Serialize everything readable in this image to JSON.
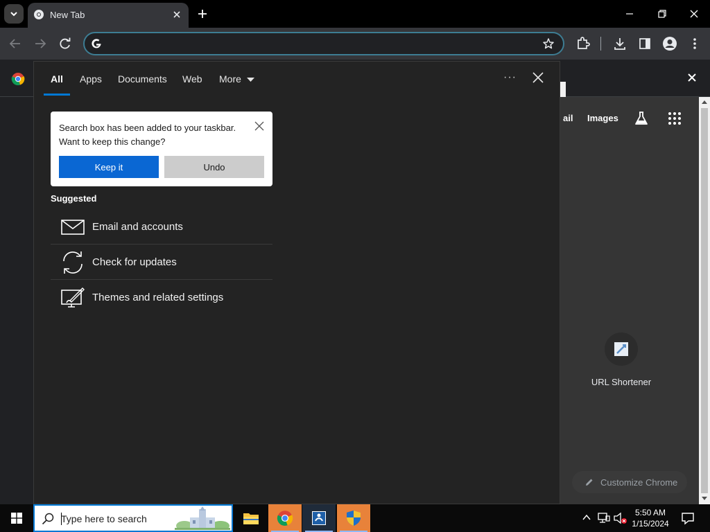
{
  "browser": {
    "tab_title": "New Tab",
    "omnibox_value": "",
    "omnibox_placeholder": ""
  },
  "ntp": {
    "link_gmail": "ail",
    "link_images": "Images",
    "shortcut_label": "URL Shortener",
    "customize_label": "Customize Chrome"
  },
  "search_panel": {
    "tabs": [
      {
        "label": "All"
      },
      {
        "label": "Apps"
      },
      {
        "label": "Documents"
      },
      {
        "label": "Web"
      },
      {
        "label": "More"
      }
    ],
    "more_options": "···",
    "toast": {
      "message": "Search box has been added to your taskbar. Want to keep this change?",
      "keep_label": "Keep it",
      "undo_label": "Undo"
    },
    "suggested_heading": "Suggested",
    "suggestions": [
      {
        "label": "Email and accounts",
        "icon": "mail-icon"
      },
      {
        "label": "Check for updates",
        "icon": "sync-icon"
      },
      {
        "label": "Themes and related settings",
        "icon": "personalize-icon"
      }
    ]
  },
  "taskbar": {
    "search_placeholder": "Type here to search",
    "time": "5:50 AM",
    "date": "1/15/2024"
  },
  "colors": {
    "accent": "#0078d4",
    "keep_button": "#0a67d3"
  }
}
